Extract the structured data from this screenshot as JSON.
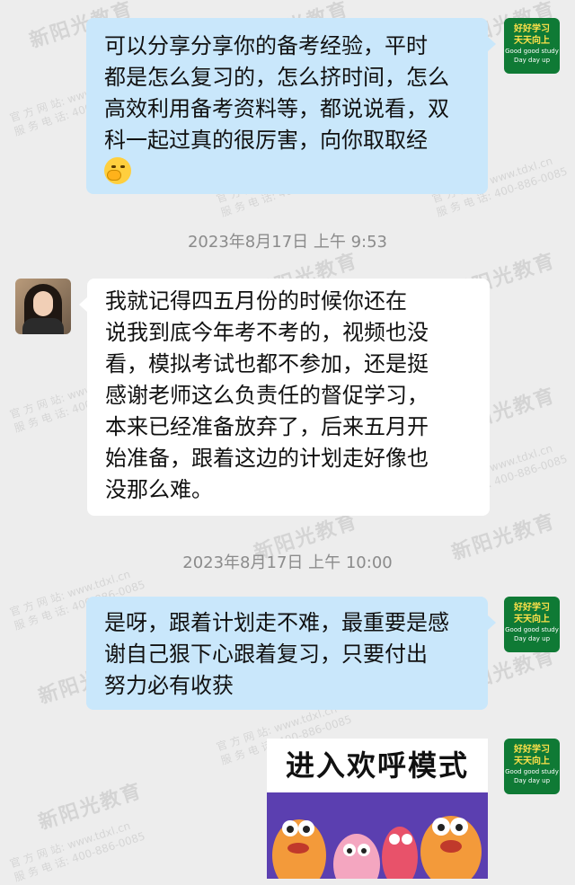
{
  "watermark": {
    "brand": "新阳光教育",
    "site_label": "官 方 网 站: www.tdxl.cn",
    "phone_label": "服 务 电 话: 400-886-0085"
  },
  "self_avatar": {
    "line1": "好好学习",
    "line2": "天天向上",
    "line3": "Good good study",
    "line4": "Day day up"
  },
  "messages": [
    {
      "id": "m1",
      "direction": "outgoing",
      "lines": [
        "可以分享分享你的备考经验，平时",
        "都是怎么复习的，怎么挤时间，怎么",
        "高效利用备考资料等，都说说看，双",
        "科一起过真的很厉害，向你取取经"
      ],
      "emoji": "thinking-face"
    },
    {
      "id": "m2",
      "direction": "incoming",
      "timestamp": "2023年8月17日  上午 9:53",
      "lines": [
        "我就记得四五月份的时候你还在",
        "说我到底今年考不考的，视频也没",
        "看，模拟考试也都不参加，还是挺",
        "感谢老师这么负责任的督促学习，",
        "本来已经准备放弃了，后来五月开",
        "始准备，跟着这边的计划走好像也",
        "没那么难。"
      ]
    },
    {
      "id": "m3",
      "direction": "outgoing",
      "timestamp": "2023年8月17日  上午 10:00",
      "lines": [
        "是呀，跟着计划走不难，最重要是感",
        "谢自己狠下心跟着复习，只要付出",
        "努力必有收获"
      ]
    },
    {
      "id": "m4",
      "direction": "outgoing",
      "sticker_text": "进入欢呼模式"
    }
  ],
  "colors": {
    "background": "#ededed",
    "outgoing_bubble": "#c9e7fb",
    "incoming_bubble": "#ffffff",
    "avatar_green": "#0f7a35"
  }
}
